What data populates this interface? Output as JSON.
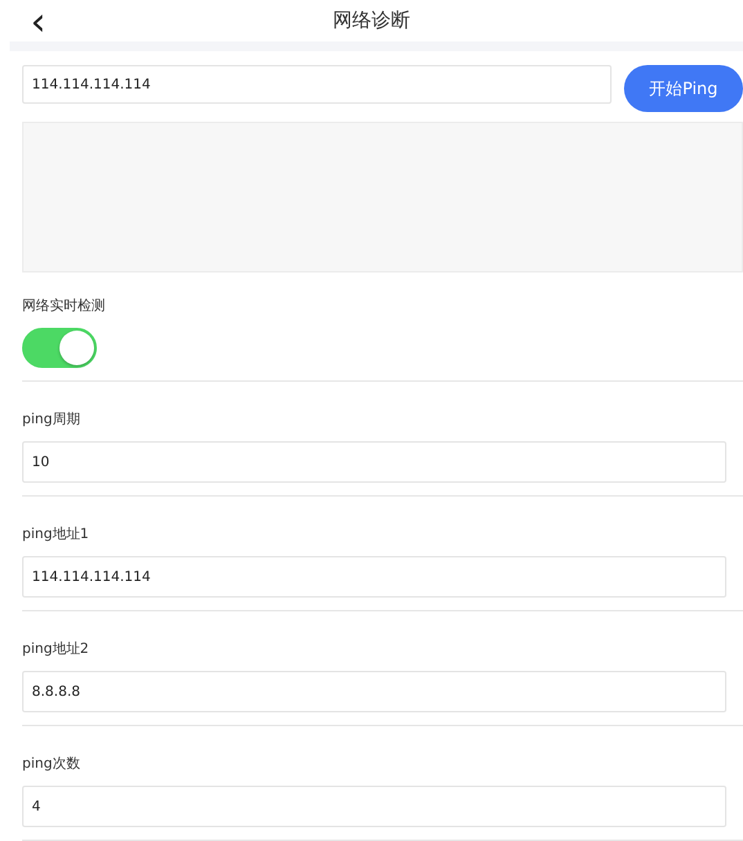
{
  "header": {
    "back": "‹",
    "title": "网络诊断"
  },
  "ping": {
    "address": "114.114.114.114",
    "button": "开始Ping"
  },
  "realtime": {
    "label": "网络实时检测",
    "on": true
  },
  "settings": [
    {
      "label": "ping周期",
      "value": "10"
    },
    {
      "label": "ping地址1",
      "value": "114.114.114.114"
    },
    {
      "label": "ping地址2",
      "value": "8.8.8.8"
    },
    {
      "label": "ping次数",
      "value": "4"
    }
  ]
}
